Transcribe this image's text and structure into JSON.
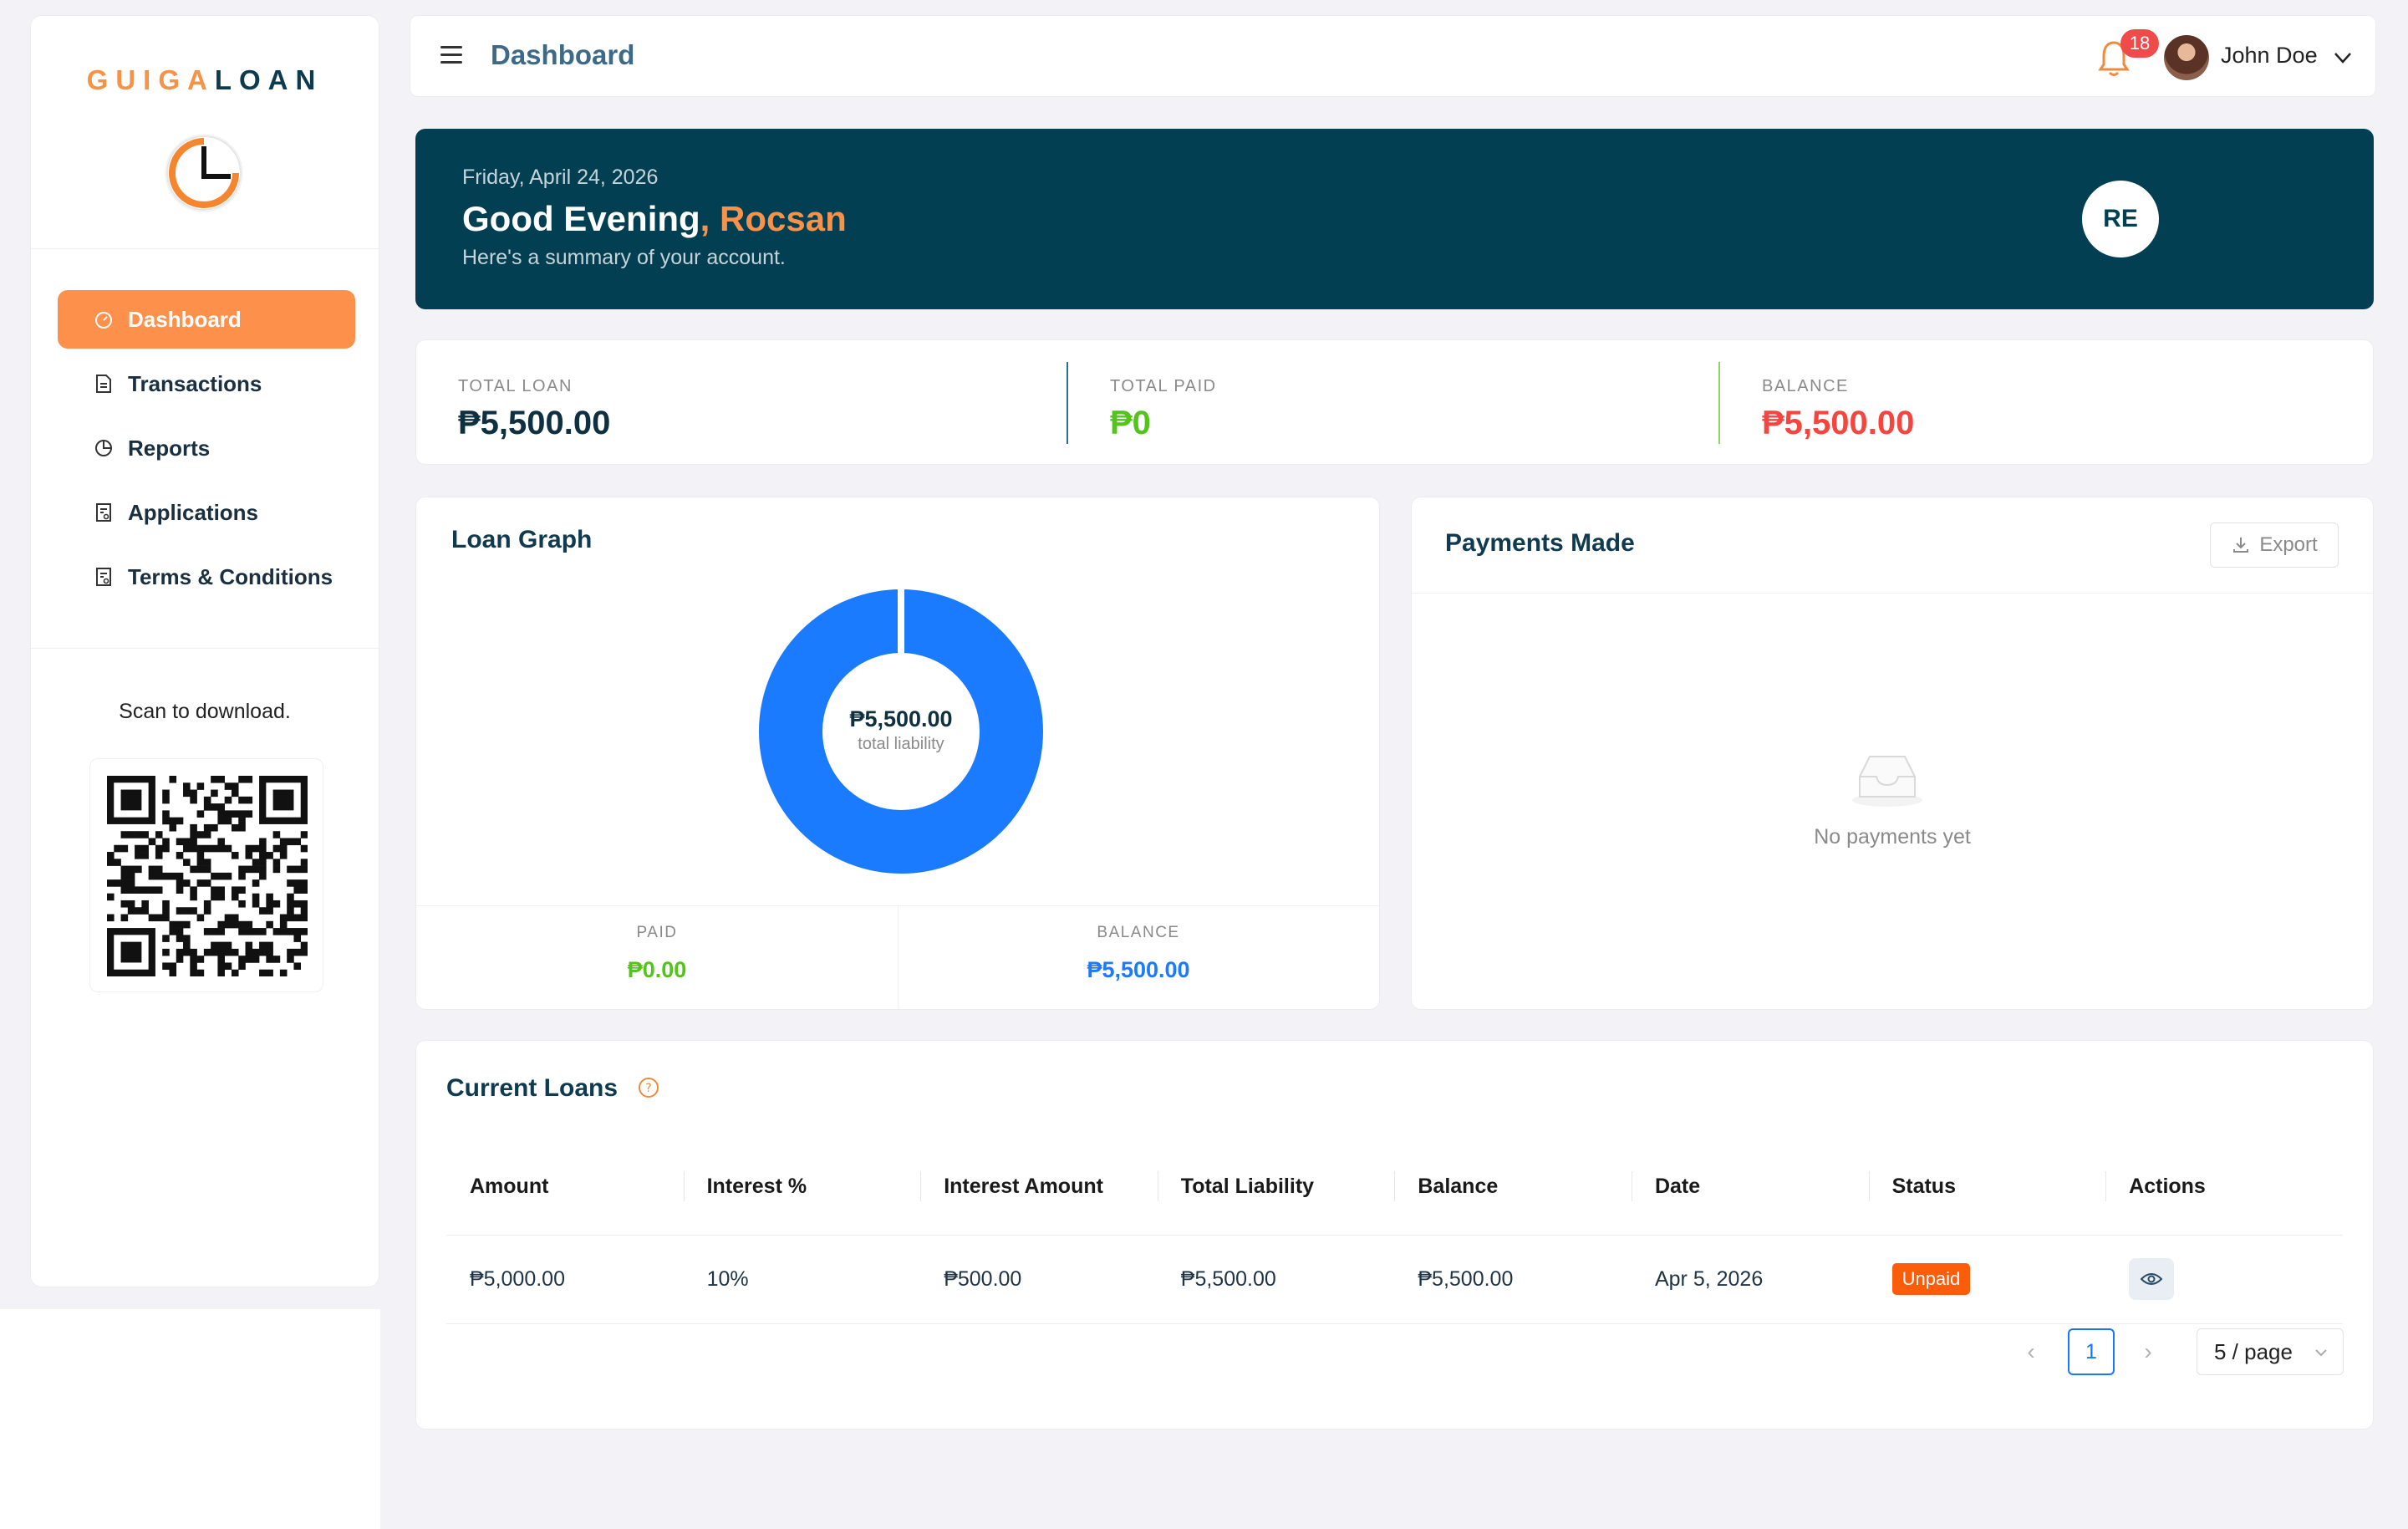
{
  "brand": {
    "part1": "GUIGA",
    "part2": "LOAN"
  },
  "sidebar": {
    "items": [
      {
        "label": "Dashboard",
        "icon": "dashboard-icon",
        "active": true
      },
      {
        "label": "Transactions",
        "icon": "document-icon"
      },
      {
        "label": "Reports",
        "icon": "pie-chart-icon"
      },
      {
        "label": "Applications",
        "icon": "form-icon"
      },
      {
        "label": "Terms & Conditions",
        "icon": "form-icon"
      }
    ],
    "scan_text": "Scan to download."
  },
  "header": {
    "title": "Dashboard",
    "notification_count": "18",
    "user_name": "John Doe"
  },
  "banner": {
    "date": "Friday, April 24, 2026",
    "greeting": "Good Evening",
    "name": ", Rocsan",
    "subtitle": "Here's a summary of your account.",
    "initials": "RE"
  },
  "summary": {
    "total_loan": {
      "label": "TOTAL LOAN",
      "value": "₱5,500.00"
    },
    "total_paid": {
      "label": "TOTAL PAID",
      "value": "₱0"
    },
    "balance": {
      "label": "BALANCE",
      "value": "₱5,500.00"
    }
  },
  "loan_graph": {
    "title": "Loan Graph",
    "center_value": "₱5,500.00",
    "center_label": "total liability",
    "paid_label": "PAID",
    "paid_value": "₱0.00",
    "balance_label": "BALANCE",
    "balance_value": "₱5,500.00",
    "paid_fraction": 0.0,
    "balance_fraction": 1.0
  },
  "payments": {
    "title": "Payments Made",
    "export_label": "Export",
    "empty_text": "No payments yet"
  },
  "current_loans": {
    "title": "Current Loans",
    "columns": [
      "Amount",
      "Interest %",
      "Interest Amount",
      "Total Liability",
      "Balance",
      "Date",
      "Status",
      "Actions"
    ],
    "rows": [
      {
        "amount": "₱5,000.00",
        "interest_pct": "10%",
        "interest_amount": "₱500.00",
        "total_liability": "₱5,500.00",
        "balance": "₱5,500.00",
        "date": "Apr 5, 2026",
        "status": "Unpaid"
      }
    ],
    "pagination": {
      "current_page": "1",
      "page_size": "5 / page"
    }
  },
  "colors": {
    "accent": "#fd914c",
    "banner_bg": "#023f52",
    "paid_green": "#52c41a",
    "balance_red": "#f5453f",
    "chart_blue": "#1b7bff",
    "unpaid_tag": "#fb5d0a"
  }
}
